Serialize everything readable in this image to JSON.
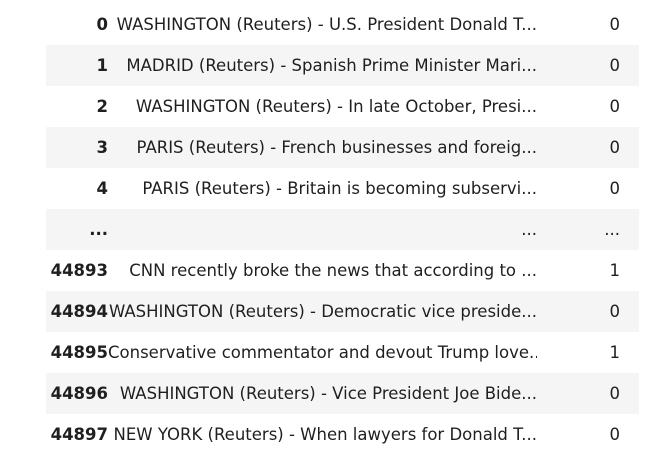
{
  "rows": [
    {
      "index": "0",
      "text": "WASHINGTON (Reuters) - U.S. President Donald T...",
      "label": "0"
    },
    {
      "index": "1",
      "text": "MADRID (Reuters) - Spanish Prime Minister Mari...",
      "label": "0"
    },
    {
      "index": "2",
      "text": "WASHINGTON (Reuters) - In late October, Presi...",
      "label": "0"
    },
    {
      "index": "3",
      "text": "PARIS (Reuters) - French businesses and foreig...",
      "label": "0"
    },
    {
      "index": "4",
      "text": "PARIS (Reuters) - Britain is becoming subservi...",
      "label": "0"
    },
    {
      "index": "...",
      "text": "...",
      "label": "..."
    },
    {
      "index": "44893",
      "text": "CNN recently broke the news that according to ...",
      "label": "1"
    },
    {
      "index": "44894",
      "text": "WASHINGTON (Reuters) - Democratic vice preside...",
      "label": "0"
    },
    {
      "index": "44895",
      "text": "Conservative commentator and devout Trump love...",
      "label": "1"
    },
    {
      "index": "44896",
      "text": "WASHINGTON (Reuters) - Vice President Joe Bide...",
      "label": "0"
    },
    {
      "index": "44897",
      "text": "NEW YORK (Reuters) - When lawyers for Donald T...",
      "label": "0"
    }
  ]
}
